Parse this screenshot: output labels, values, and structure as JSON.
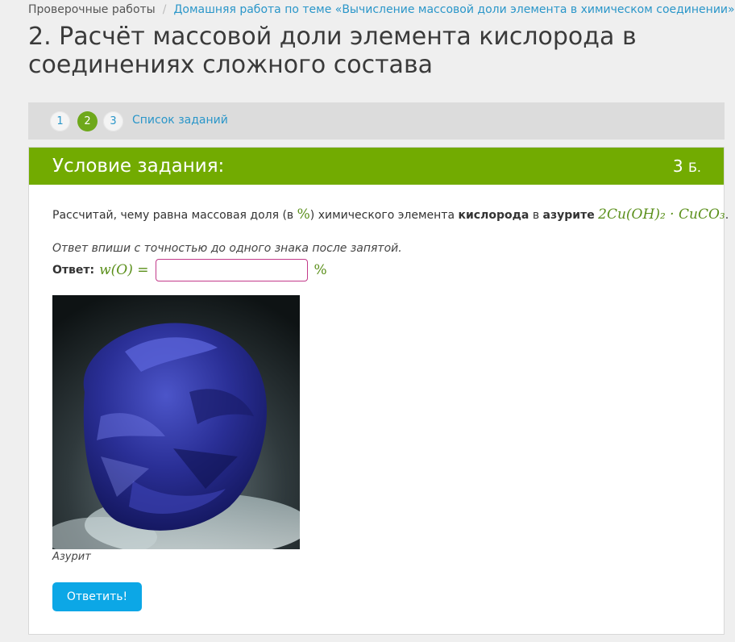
{
  "breadcrumb": {
    "root": "Проверочные работы",
    "separator": "/",
    "current": "Домашняя работа по теме «Вычисление массовой доли элемента в химическом соединении»"
  },
  "title": "2. Расчёт массовой доли элемента кислорода в соединениях сложного состава",
  "pager": {
    "items": [
      "1",
      "2",
      "3"
    ],
    "active": "2",
    "list_link": "Список заданий"
  },
  "panel": {
    "header_title": "Условие задания:",
    "points_value": "3",
    "points_unit": "Б."
  },
  "question": {
    "part1": "Рассчитай, чему равна массовая доля (в ",
    "percent_symbol": "%",
    "part2": ") химического элемента ",
    "element": "кислорода",
    "part3": " в ",
    "substance": "азурите",
    "formula": "2Cu(OH)₂ · CuCO₃",
    "end": "."
  },
  "note": "Ответ впиши с точностью до одного знака после запятой.",
  "answer": {
    "label": "Ответ:",
    "math_label": "w(O) =",
    "value": "",
    "unit": "%"
  },
  "image": {
    "caption": "Азурит",
    "icon": "azurite-mineral-photo"
  },
  "submit_label": "Ответить!",
  "colors": {
    "green_header": "#72ab01",
    "active_page": "#6ea81a",
    "link_blue": "#2a96c9",
    "button_blue": "#0ca7e6",
    "input_border": "#c23a8a",
    "math_green": "#5a8f1a"
  }
}
